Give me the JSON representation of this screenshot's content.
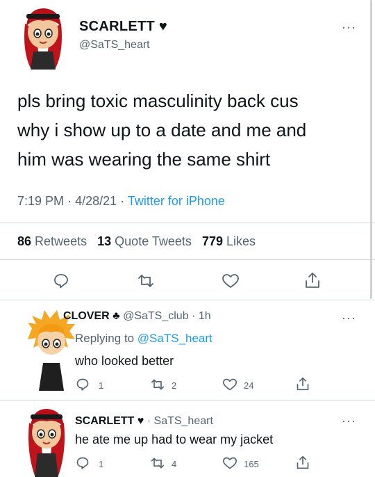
{
  "main_tweet": {
    "display_name": "SCARLETT ♥",
    "handle": "@SaTS_heart",
    "text_lines": [
      "pls bring toxic masculinity back cus",
      "why i show up to a date and me and",
      "him was wearing the same shirt"
    ],
    "time": "7:19 PM",
    "date": "4/28/21",
    "source": "Twitter for iPhone",
    "retweets_count": "86",
    "retweets_label": "Retweets",
    "quotes_count": "13",
    "quotes_label": "Quote Tweets",
    "likes_count": "779",
    "likes_label": "Likes"
  },
  "reply1": {
    "display_name": "CLOVER ♣",
    "handle": "@SaTS_club",
    "age": "1h",
    "replying_prefix": "Replying to",
    "replying_handle": "@SaTS_heart",
    "text": "who looked better",
    "reply_count": "1",
    "retweet_count": "2",
    "like_count": "24"
  },
  "reply2": {
    "display_name": "SCARLETT ♥",
    "handle": "SaTS_heart",
    "text": "he ate me up had to wear my jacket",
    "reply_count": "1",
    "retweet_count": "4",
    "like_count": "165"
  },
  "icons": [
    "more-dots-icon",
    "reply-icon",
    "retweet-icon",
    "like-icon",
    "share-icon"
  ],
  "colors": {
    "accent": "#1d9bf0",
    "text": "#0f1419",
    "muted": "#536471",
    "divider": "#cfd9de"
  }
}
